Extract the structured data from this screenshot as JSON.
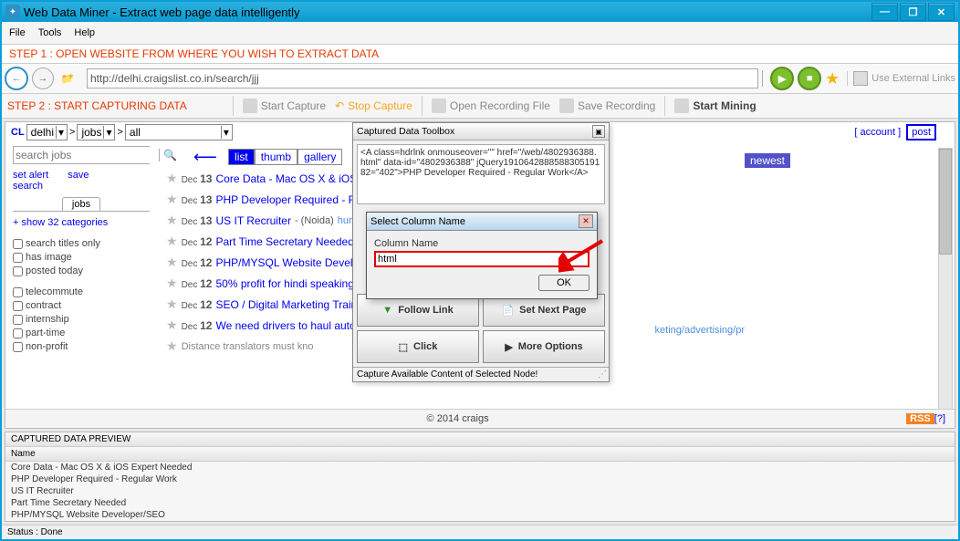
{
  "title": "Web Data Miner -  Extract web page data intelligently",
  "menubar": [
    "File",
    "Tools",
    "Help"
  ],
  "step1": "STEP 1 : OPEN WEBSITE FROM WHERE YOU WISH TO EXTRACT DATA",
  "address": "http://delhi.craigslist.co.in/search/jjj",
  "ext_links": "Use External Links",
  "step2": "STEP 2 : START CAPTURING DATA",
  "tb": {
    "start": "Start Capture",
    "stop": "Stop Capture",
    "open": "Open Recording File",
    "save": "Save Recording",
    "mine": "Start Mining"
  },
  "cl": {
    "brand": "CL",
    "loc": "delhi",
    "sec": "jobs",
    "cat": "all",
    "account": "account",
    "post": "post",
    "search_ph": "search jobs",
    "set_alert": "set alert",
    "save": "save",
    "search": "search",
    "side_tab": "jobs",
    "showcat": "+ show 32 categories",
    "filters1": [
      "search titles only",
      "has image",
      "posted today"
    ],
    "filters2": [
      "telecommute",
      "contract",
      "internship",
      "part-time",
      "non-profit"
    ],
    "tabs": [
      "list",
      "thumb",
      "gallery"
    ],
    "newest": "newest",
    "jobs": [
      {
        "d": "Dec",
        "n": "13",
        "t": "Core Data - Mac OS X & iOS"
      },
      {
        "d": "Dec",
        "n": "13",
        "t": "PHP Developer Required - Re"
      },
      {
        "d": "Dec",
        "n": "13",
        "t": "US IT Recruiter",
        "tail": " - (Noida)",
        "meta": "huma"
      },
      {
        "d": "Dec",
        "n": "12",
        "t": "Part Time Secretary Needed -"
      },
      {
        "d": "Dec",
        "n": "12",
        "t": "PHP/MYSQL Website Devel"
      },
      {
        "d": "Dec",
        "n": "12",
        "t": "50% profit for hindi speaking b"
      },
      {
        "d": "Dec",
        "n": "12",
        "t": "SEO / Digital Marketing Train"
      },
      {
        "d": "Dec",
        "n": "12",
        "t": "We need drivers to haul auto p"
      }
    ],
    "partial": "keting/advertising/pr",
    "truncated_last": "Distance translators  must kno",
    "footer": "© 2014 craigs",
    "rss": "RSS",
    "q": "[?]"
  },
  "toolbox": {
    "title": "Captured Data Toolbox",
    "code": "<A class=hdrlnk onmouseover=\"\" href=\"/web/4802936388.html\" data-id=\"4802936388\" jQuery191064288858830519182=\"402\">PHP Developer Required - Regular Work</A>",
    "follow": "Follow Link",
    "next": "Set Next Page",
    "click": "Click",
    "more": "More Options",
    "status": "Capture Available Content of Selected Node!"
  },
  "dialog": {
    "title": "Select Column Name",
    "label": "Column Name",
    "value": "html",
    "ok": "OK"
  },
  "preview": {
    "title": "CAPTURED DATA PREVIEW",
    "col": "Name",
    "rows": [
      "Core Data - Mac OS X & iOS Expert Needed",
      "PHP Developer Required - Regular Work",
      "US IT Recruiter",
      "Part Time Secretary Needed",
      "PHP/MYSQL Website Developer/SEO"
    ]
  },
  "statusbar": "Status :  Done"
}
